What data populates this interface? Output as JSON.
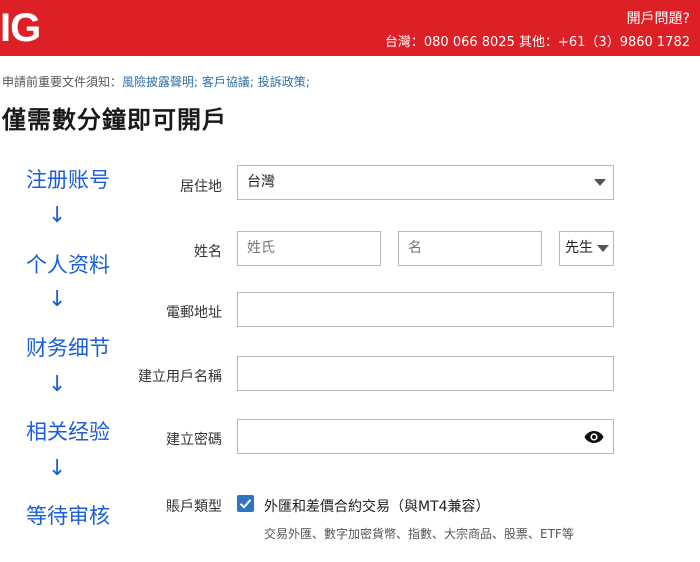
{
  "header": {
    "logo": "IG",
    "help_link": "開戶問題?",
    "phones": "台灣：080 066 8025 其他：+61（3）9860 1782"
  },
  "notice": {
    "prefix": "申請前重要文件須知：",
    "links": [
      "風險披露聲明",
      "客戶協議",
      "投訴政策"
    ],
    "sep": ";"
  },
  "page_title": "僅需數分鐘即可開戶",
  "steps": {
    "items": [
      "注册账号",
      "个人资料",
      "财务细节",
      "相关经验",
      "等待审核"
    ],
    "arrow": "↓"
  },
  "form": {
    "residence": {
      "label": "居住地",
      "value": "台灣"
    },
    "name": {
      "label": "姓名",
      "surname_placeholder": "姓氏",
      "given_placeholder": "名",
      "title_value": "先生"
    },
    "email": {
      "label": "電郵地址",
      "value": ""
    },
    "username": {
      "label": "建立用戶名稱",
      "value": ""
    },
    "password": {
      "label": "建立密碼",
      "value": ""
    },
    "account_type": {
      "label": "賬戶類型",
      "option_label": "外匯和差價合約交易（與MT4兼容）",
      "option_checked": true,
      "option_desc": "交易外匯、數字加密貨幣、指數、大宗商品、股票、ETF等"
    }
  },
  "colors": {
    "brand_red": "#dd1f26",
    "link_blue": "#2f6fa8",
    "annotation_blue": "#1a5fd8",
    "checkbox_blue": "#2f74c0"
  }
}
